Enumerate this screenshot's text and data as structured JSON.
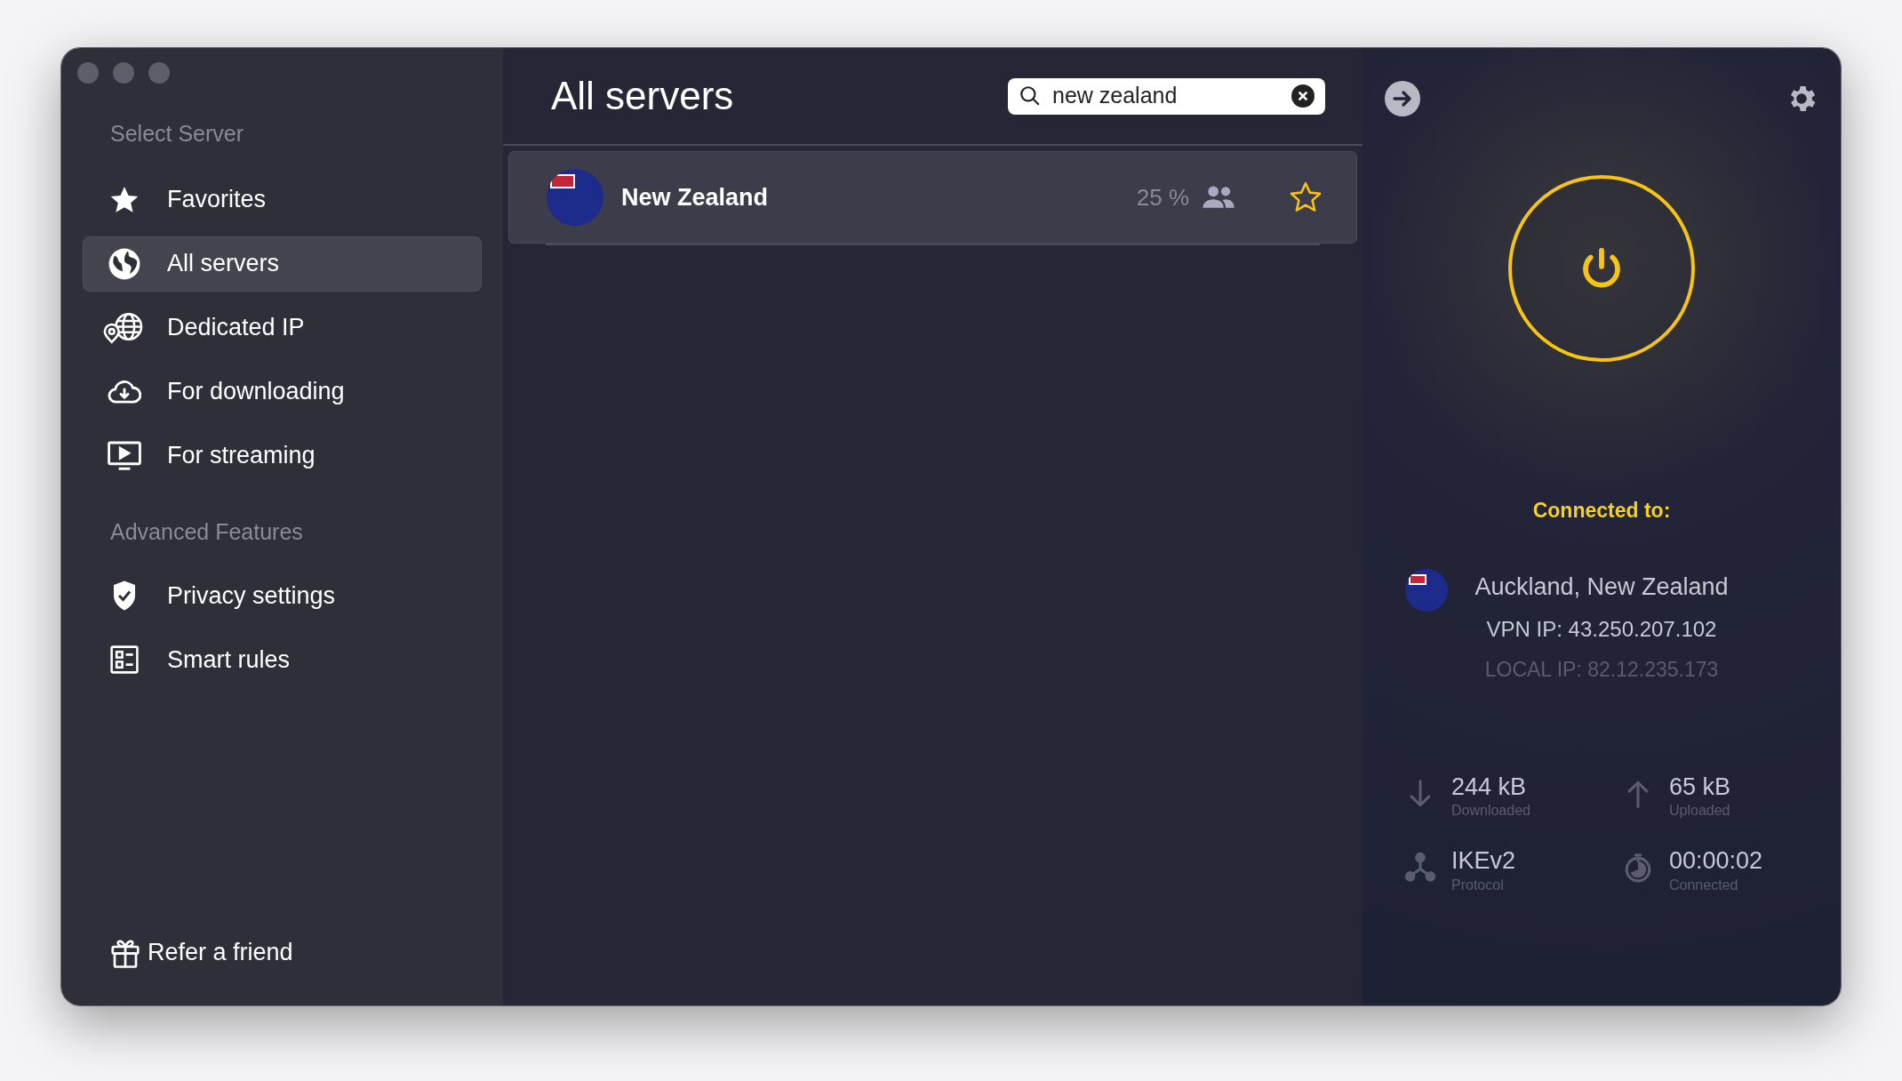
{
  "sidebar": {
    "sections": [
      {
        "heading": "Select Server",
        "items": [
          {
            "label": "Favorites",
            "selected": false
          },
          {
            "label": "All servers",
            "selected": true
          },
          {
            "label": "Dedicated IP",
            "selected": false
          },
          {
            "label": "For downloading",
            "selected": false
          },
          {
            "label": "For streaming",
            "selected": false
          }
        ]
      },
      {
        "heading": "Advanced Features",
        "items": [
          {
            "label": "Privacy settings",
            "selected": false
          },
          {
            "label": "Smart rules",
            "selected": false
          }
        ]
      }
    ],
    "footer": "Refer a friend"
  },
  "main": {
    "title": "All servers",
    "search": {
      "value": "new zealand"
    },
    "servers": [
      {
        "name": "New Zealand",
        "load": "25 %",
        "favorite": false
      }
    ]
  },
  "status": {
    "connected_label": "Connected to:",
    "location": "Auckland, New Zealand",
    "vpn_ip": "VPN IP: 43.250.207.102",
    "local_ip": "LOCAL IP: 82.12.235.173",
    "stats": [
      {
        "value": "244 kB",
        "label": "Downloaded"
      },
      {
        "value": "65 kB",
        "label": "Uploaded"
      },
      {
        "value": "IKEv2",
        "label": "Protocol"
      },
      {
        "value": "00:00:02",
        "label": "Connected"
      }
    ]
  }
}
